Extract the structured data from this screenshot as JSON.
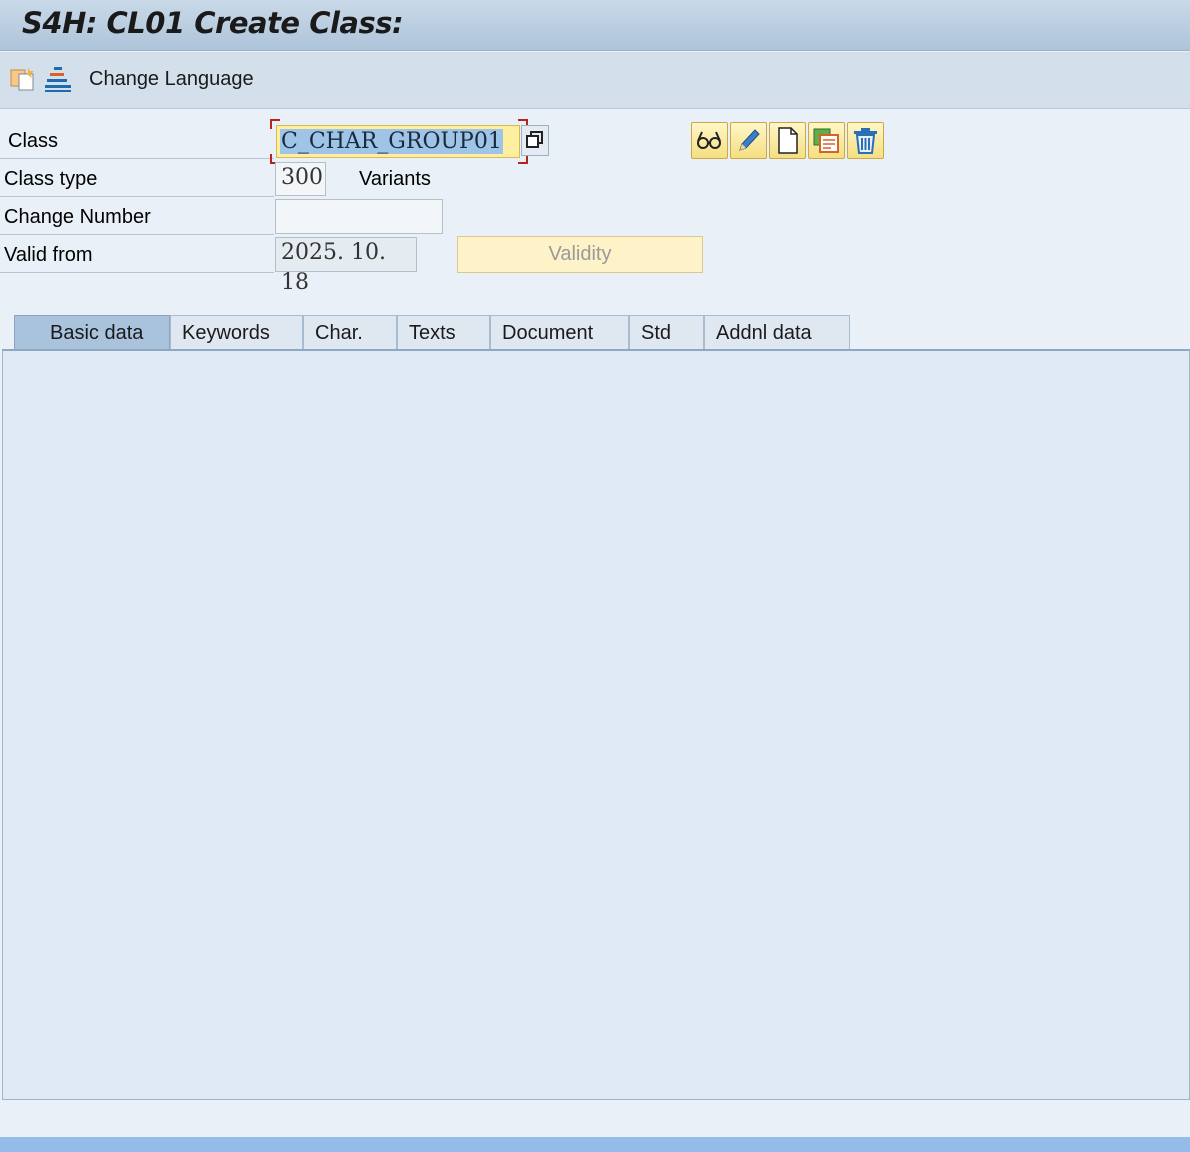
{
  "window": {
    "title": "S4H: CL01 Create Class:"
  },
  "toolbar": {
    "icons": [
      "copy-new-icon",
      "hierarchy-icon"
    ],
    "change_language_label": "Change Language"
  },
  "form": {
    "class_label": "Class",
    "class_value": "C_CHAR_GROUP01",
    "class_type_label": "Class type",
    "class_type_value": "300",
    "class_type_text": "Variants",
    "change_number_label": "Change Number",
    "change_number_value": "",
    "valid_from_label": "Valid from",
    "valid_from_value": "2025. 10. 18",
    "validity_button": "Validity"
  },
  "actions": [
    "display-icon",
    "edit-icon",
    "create-icon",
    "copy-icon",
    "delete-icon"
  ],
  "tabs": [
    {
      "label": "Basic data",
      "active": true
    },
    {
      "label": "Keywords"
    },
    {
      "label": "Char."
    },
    {
      "label": "Texts"
    },
    {
      "label": "Document"
    },
    {
      "label": "Std"
    },
    {
      "label": "Addnl data"
    }
  ],
  "colors": {
    "accent": "#93bce9",
    "input_focus": "#fdeea0",
    "active_tab": "#a9c3dd"
  }
}
